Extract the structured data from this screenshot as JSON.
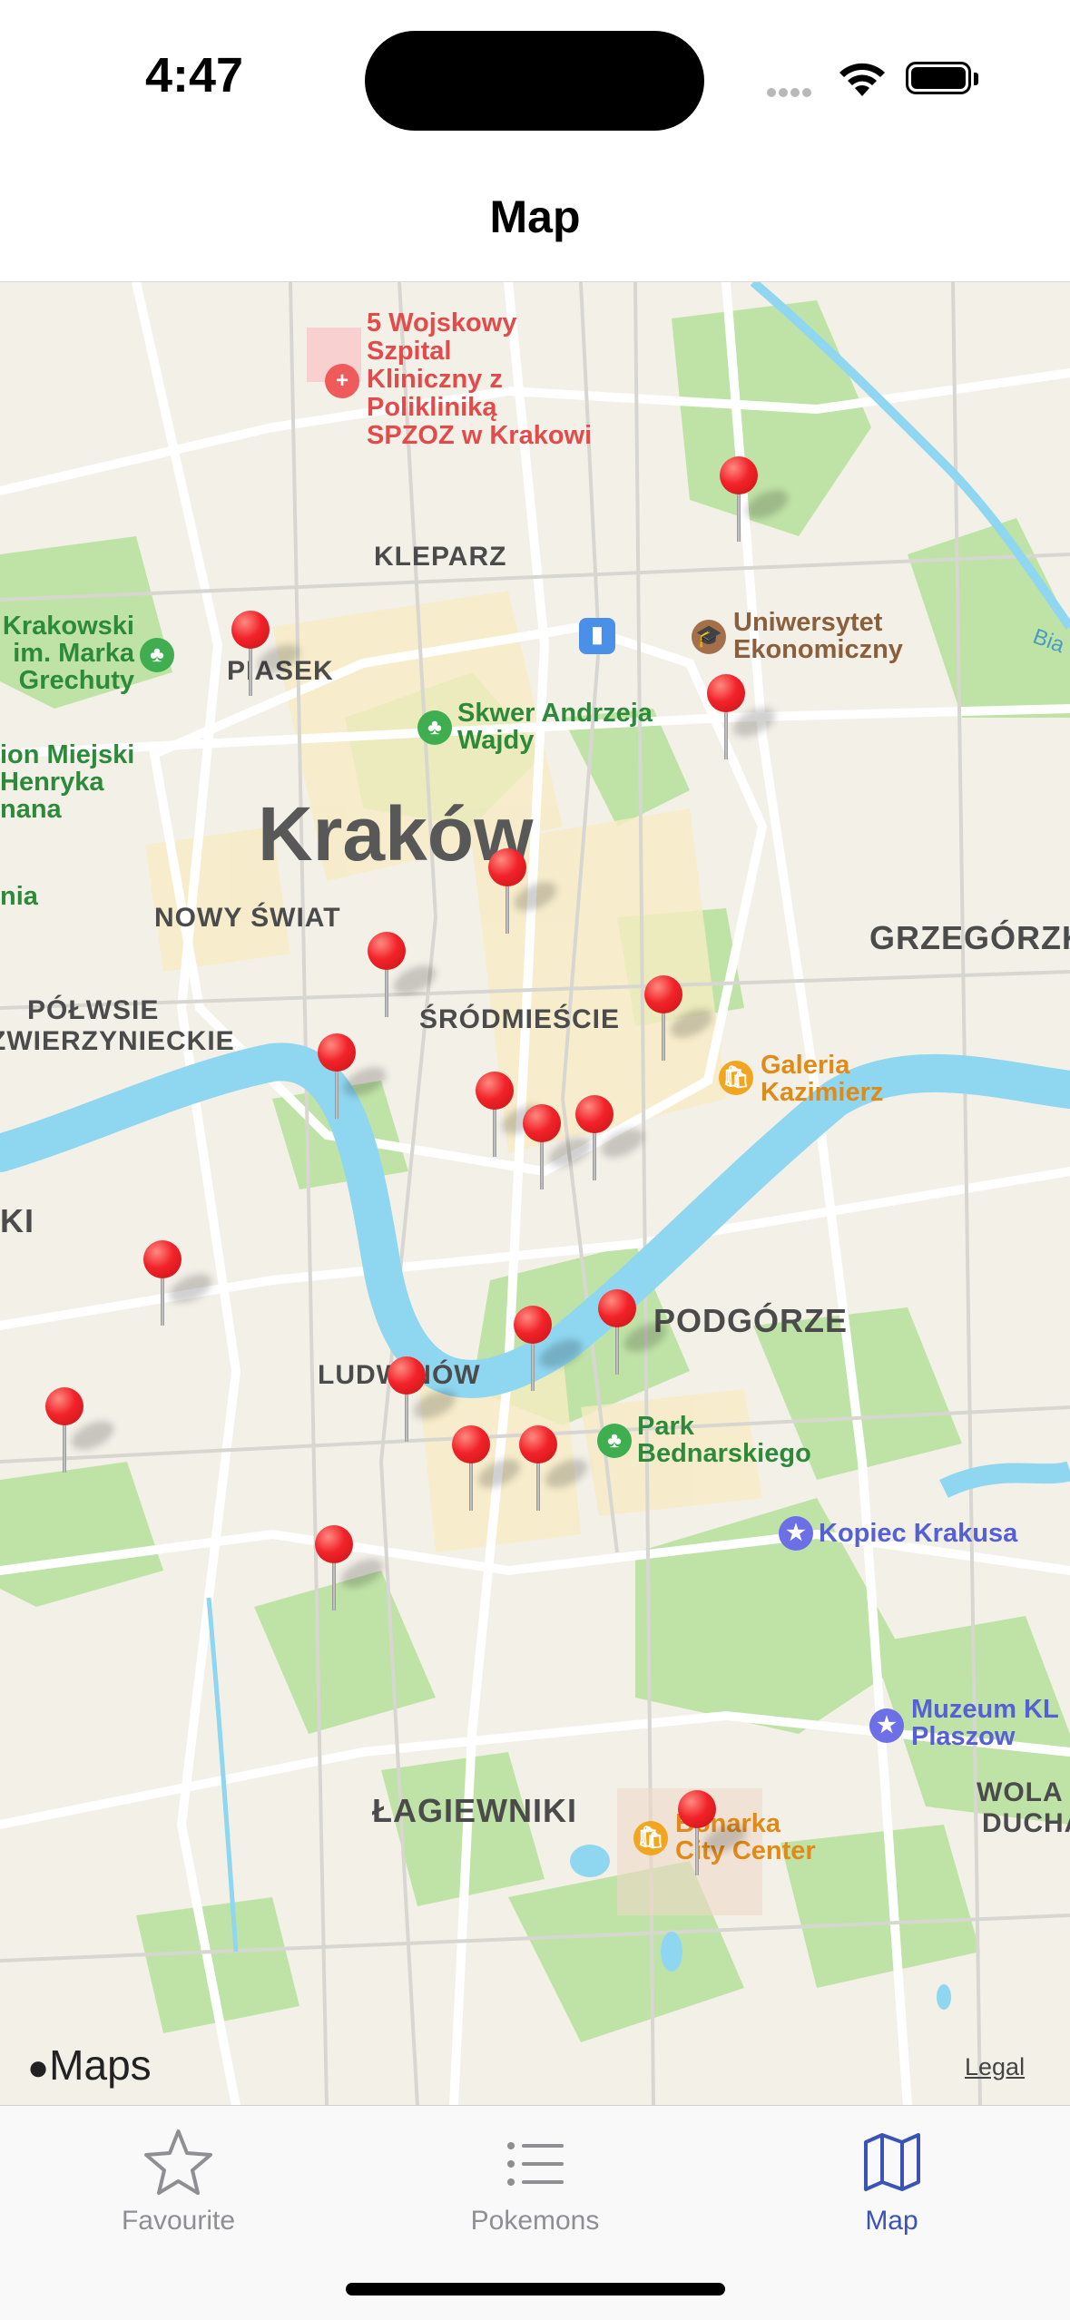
{
  "status_bar": {
    "time": "4:47"
  },
  "nav": {
    "title": "Map"
  },
  "map": {
    "city": "Kraków",
    "districts": [
      "KLEPARZ",
      "PIASEK",
      "NOWY ŚWIAT",
      "ŚRÓDMIEŚCIE",
      "PÓŁWSIE",
      "ZWIERZYNIECKIE",
      "GRZEGÓRZK",
      "PODGÓRZE",
      "LUDWINÓW",
      "ŁAGIEWNIKI",
      "WOLA",
      "DUCHACKA",
      "KI"
    ],
    "pois": {
      "hospital": [
        "5 Wojskowy",
        "Szpital",
        "Kliniczny z",
        "Polikliniką",
        "SPZOZ w Krakowi"
      ],
      "university": [
        "Uniwersytet",
        "Ekonomiczny"
      ],
      "park_wajdy": [
        "Skwer Andrzeja",
        "Wajdy"
      ],
      "park_grechuty": [
        "Krakowski",
        "im. Marka",
        "Grechuty"
      ],
      "park_miejski": [
        "ion Miejski",
        "Henryka",
        "nana"
      ],
      "park_nia": "nia",
      "galeria": [
        "Galeria",
        "Kazimierz"
      ],
      "park_bednarskiego": [
        "Park",
        "Bednarskiego"
      ],
      "kopiec": "Kopiec Krakusa",
      "muzeum": [
        "Muzeum KL",
        "Plaszow"
      ],
      "bonarka": [
        "Bonarka",
        "City Center"
      ],
      "river": "Bia"
    },
    "pin_count": 19,
    "attribution": "Maps",
    "legal": "Legal"
  },
  "tabs": [
    {
      "label": "Favourite",
      "icon": "star-icon",
      "active": false
    },
    {
      "label": "Pokemons",
      "icon": "list-icon",
      "active": false
    },
    {
      "label": "Map",
      "icon": "map-icon",
      "active": true
    }
  ],
  "colors": {
    "accent": "#3a53b6",
    "pin": "#f2232a",
    "water": "#8fd6f0",
    "park": "#bfe3a6"
  }
}
